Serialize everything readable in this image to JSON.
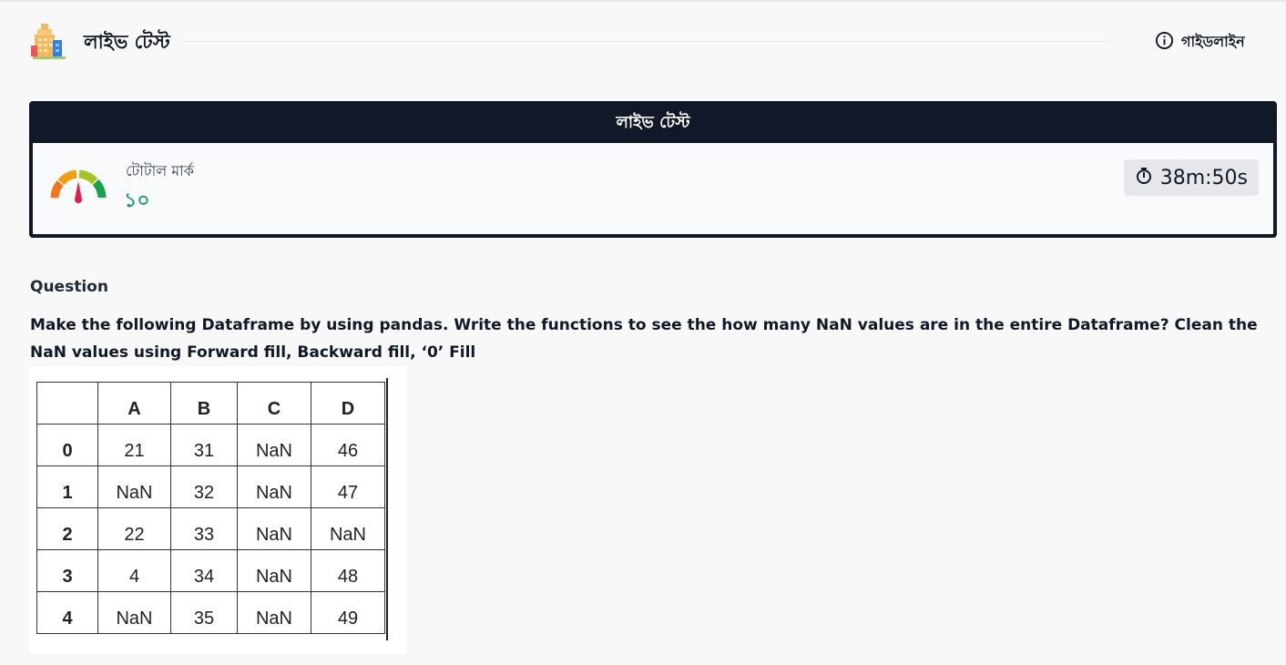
{
  "header": {
    "title": "লাইভ টেস্ট",
    "guideline_label": "গাইডলাইন",
    "logo_icon": "building-logo-icon",
    "guide_icon": "info-circle-icon"
  },
  "card": {
    "title": "লাইভ টেস্ট",
    "marks_label": "টোটাল মার্ক",
    "marks_value": "১০",
    "timer_value": "38m:50s",
    "gauge_icon": "speedometer-gauge-icon",
    "timer_icon": "stopwatch-icon"
  },
  "question": {
    "label": "Question",
    "text": "Make the following Dataframe by using pandas. Write the functions to see the how many NaN values are in the entire Dataframe? Clean the NaN values using Forward fill, Backward fill, ‘0’ Fill"
  },
  "dataframe": {
    "columns": [
      "",
      "A",
      "B",
      "C",
      "D"
    ],
    "rows": [
      [
        "0",
        "21",
        "31",
        "NaN",
        "46"
      ],
      [
        "1",
        "NaN",
        "32",
        "NaN",
        "47"
      ],
      [
        "2",
        "22",
        "33",
        "NaN",
        "NaN"
      ],
      [
        "3",
        "4",
        "34",
        "NaN",
        "48"
      ],
      [
        "4",
        "NaN",
        "35",
        "NaN",
        "49"
      ]
    ]
  },
  "colors": {
    "dark": "#111827",
    "accent_green": "#22a06b",
    "background": "#f8f8f8"
  }
}
